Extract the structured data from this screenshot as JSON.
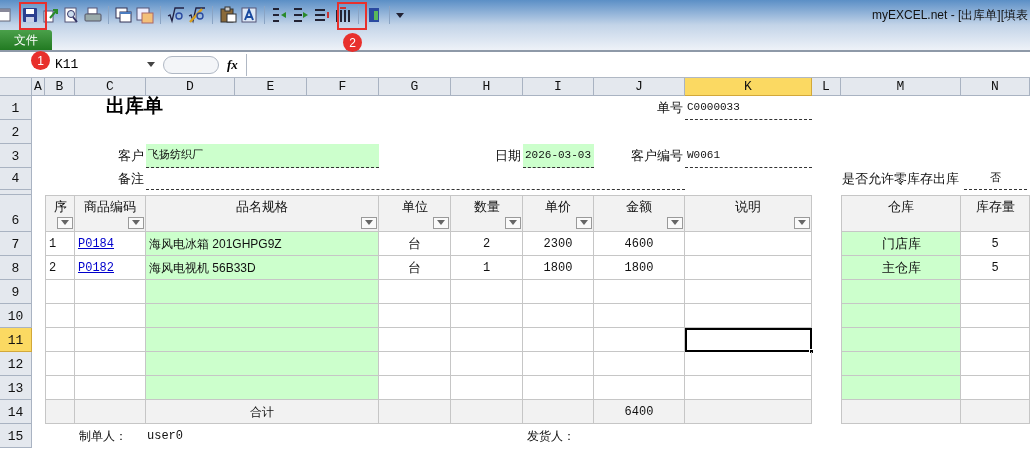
{
  "window": {
    "title": "myEXCEL.net - [出库单][填表"
  },
  "ribbon": {
    "file_tab": "文件"
  },
  "callouts": [
    {
      "label": "1"
    },
    {
      "label": "2"
    }
  ],
  "formula_bar": {
    "cell_ref": "K11",
    "fx": "fx"
  },
  "columns": [
    {
      "label": "A",
      "selected": false
    },
    {
      "label": "B",
      "selected": false
    },
    {
      "label": "C",
      "selected": false
    },
    {
      "label": "D",
      "selected": false
    },
    {
      "label": "E",
      "selected": false
    },
    {
      "label": "F",
      "selected": false
    },
    {
      "label": "G",
      "selected": false
    },
    {
      "label": "H",
      "selected": false
    },
    {
      "label": "I",
      "selected": false
    },
    {
      "label": "J",
      "selected": false
    },
    {
      "label": "K",
      "selected": true
    },
    {
      "label": "L",
      "selected": false
    },
    {
      "label": "M",
      "selected": false
    },
    {
      "label": "N",
      "selected": false
    }
  ],
  "rows": [
    {
      "label": "1",
      "selected": false
    },
    {
      "label": "2",
      "selected": false
    },
    {
      "label": "3",
      "selected": false
    },
    {
      "label": "4",
      "selected": false
    },
    {
      "label": "6",
      "selected": false
    },
    {
      "label": "7",
      "selected": false
    },
    {
      "label": "8",
      "selected": false
    },
    {
      "label": "9",
      "selected": false
    },
    {
      "label": "10",
      "selected": false
    },
    {
      "label": "11",
      "selected": true
    },
    {
      "label": "12",
      "selected": false
    },
    {
      "label": "13",
      "selected": false
    },
    {
      "label": "14",
      "selected": false
    },
    {
      "label": "15",
      "selected": false
    }
  ],
  "form": {
    "title": "出库单",
    "fields": [
      {
        "label": "单号",
        "value": "C0000033"
      },
      {
        "label": "客户",
        "value": "飞扬纺织厂"
      },
      {
        "label": "日期",
        "value": "2026-03-03"
      },
      {
        "label": "客户编号",
        "value": "W0061"
      },
      {
        "label": "备注"
      },
      {
        "label": "是否允许零库存出库",
        "value": "否"
      }
    ]
  },
  "table": {
    "columns": [
      {
        "label": "序",
        "filter": true
      },
      {
        "label": "商品编码",
        "filter": true
      },
      {
        "label": "品名规格",
        "filter": true
      },
      {
        "label": "单位",
        "filter": true
      },
      {
        "label": "数量",
        "filter": true
      },
      {
        "label": "单价",
        "filter": true
      },
      {
        "label": "金额",
        "filter": true
      },
      {
        "label": "说明",
        "filter": true
      },
      {
        "label": "仓库",
        "filter": false
      },
      {
        "label": "库存量",
        "filter": false
      }
    ],
    "rows": [
      {
        "kind": "item",
        "seq": "1",
        "code": "P0184",
        "name": "海风电冰箱 201GHPG9Z",
        "unit": "台",
        "qty": "2",
        "price": "2300",
        "amount": "4600",
        "warehouse": "门店库",
        "stock": "5",
        "note_selected": false
      },
      {
        "kind": "item",
        "seq": "2",
        "code": "P0182",
        "name": "海风电视机 56B33D",
        "unit": "台",
        "qty": "1",
        "price": "1800",
        "amount": "1800",
        "warehouse": "主仓库",
        "stock": "5",
        "note_selected": false
      },
      {
        "kind": "empty",
        "note_selected": false
      },
      {
        "kind": "empty",
        "note_selected": false
      },
      {
        "kind": "empty",
        "note_selected": true
      },
      {
        "kind": "empty",
        "note_selected": false
      },
      {
        "kind": "empty",
        "note_selected": false
      },
      {
        "kind": "total",
        "label": "合计",
        "amount": "6400"
      }
    ]
  },
  "footer": [
    {
      "label": "制单人：",
      "value": "user0"
    },
    {
      "label": "发货人："
    }
  ]
}
